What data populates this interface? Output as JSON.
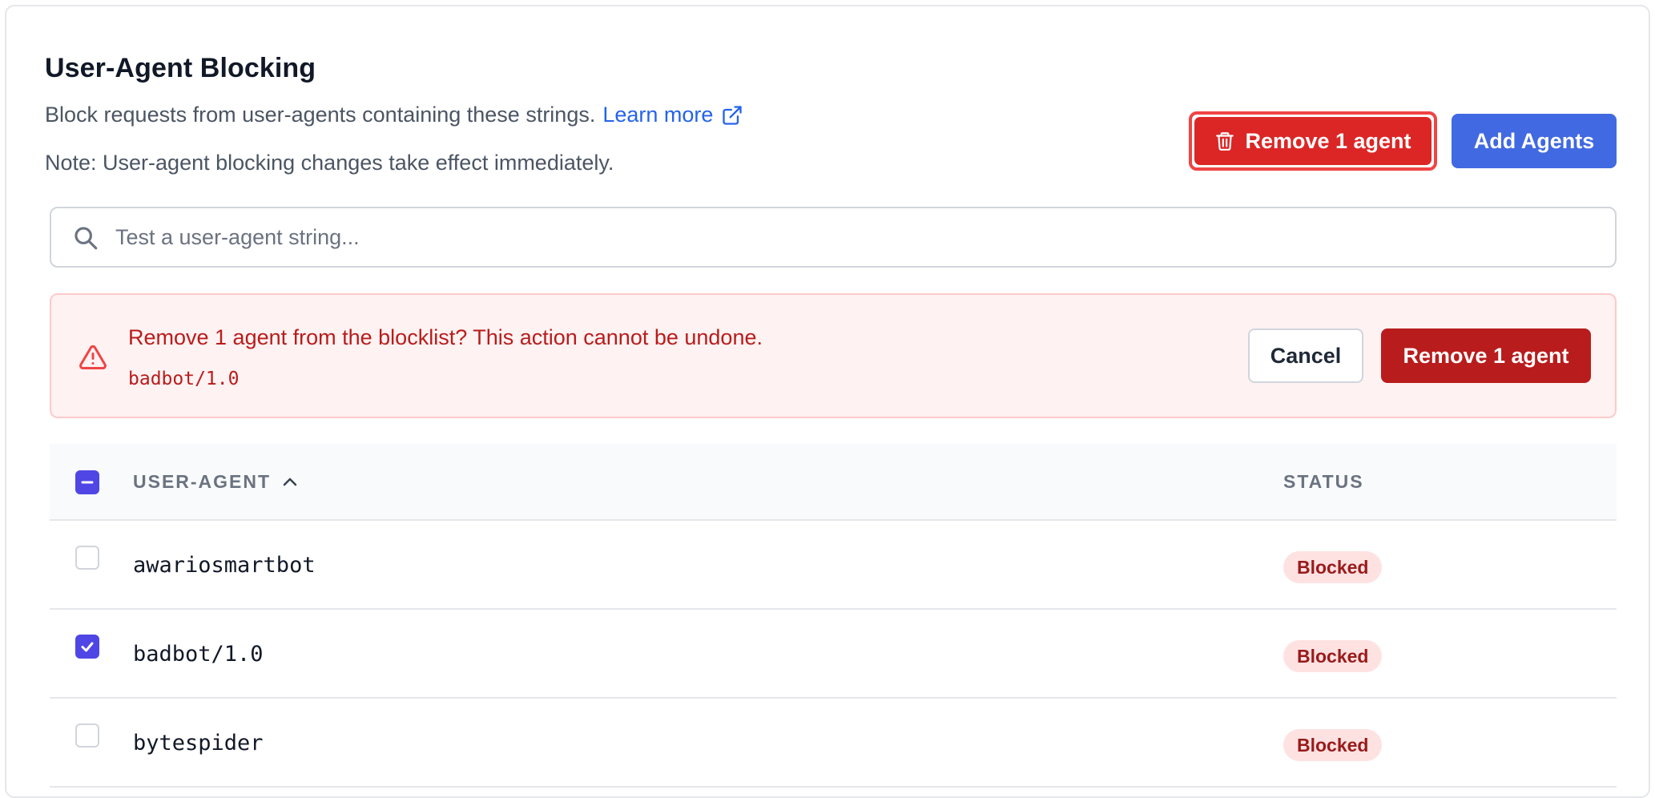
{
  "header": {
    "title": "User-Agent Blocking",
    "description": "Block requests from user-agents containing these strings.",
    "learn_more": "Learn more",
    "note": "Note: User-agent blocking changes take effect immediately."
  },
  "toolbar": {
    "remove_label": "Remove 1 agent",
    "add_label": "Add Agents"
  },
  "search": {
    "placeholder": "Test a user-agent string...",
    "value": ""
  },
  "alert": {
    "message": "Remove 1 agent from the blocklist? This action cannot be undone.",
    "agent": "badbot/1.0",
    "cancel_label": "Cancel",
    "confirm_label": "Remove 1 agent"
  },
  "table": {
    "columns": {
      "user_agent": "USER-AGENT",
      "status": "STATUS"
    },
    "header_checkbox_state": "indeterminate",
    "rows": [
      {
        "name": "awariosmartbot",
        "status": "Blocked",
        "checked": false
      },
      {
        "name": "badbot/1.0",
        "status": "Blocked",
        "checked": true
      },
      {
        "name": "bytespider",
        "status": "Blocked",
        "checked": false
      }
    ]
  },
  "colors": {
    "danger": "#dc2626",
    "danger_dark": "#b91c1c",
    "primary": "#4169e1",
    "checkbox": "#4f46e5",
    "link": "#2563eb"
  },
  "icons": {
    "remove_button": "trash-icon",
    "learn_more": "external-link-icon",
    "search": "search-icon",
    "alert": "warning-triangle-icon",
    "sort": "chevron-up-icon"
  }
}
